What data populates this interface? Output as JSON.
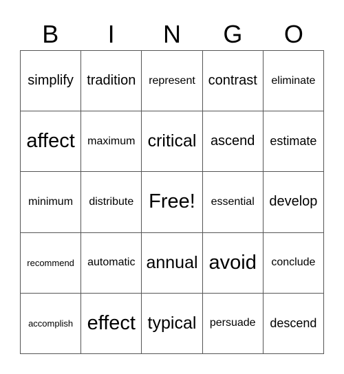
{
  "header": {
    "letters": [
      "B",
      "I",
      "N",
      "G",
      "O"
    ]
  },
  "grid": {
    "rows": [
      [
        "simplify",
        "tradition",
        "represent",
        "contrast",
        "eliminate"
      ],
      [
        "affect",
        "maximum",
        "critical",
        "ascend",
        "estimate"
      ],
      [
        "minimum",
        "distribute",
        "Free!",
        "essential",
        "develop"
      ],
      [
        "recommend",
        "automatic",
        "annual",
        "avoid",
        "conclude"
      ],
      [
        "accomplish",
        "effect",
        "typical",
        "persuade",
        "descend"
      ]
    ]
  }
}
